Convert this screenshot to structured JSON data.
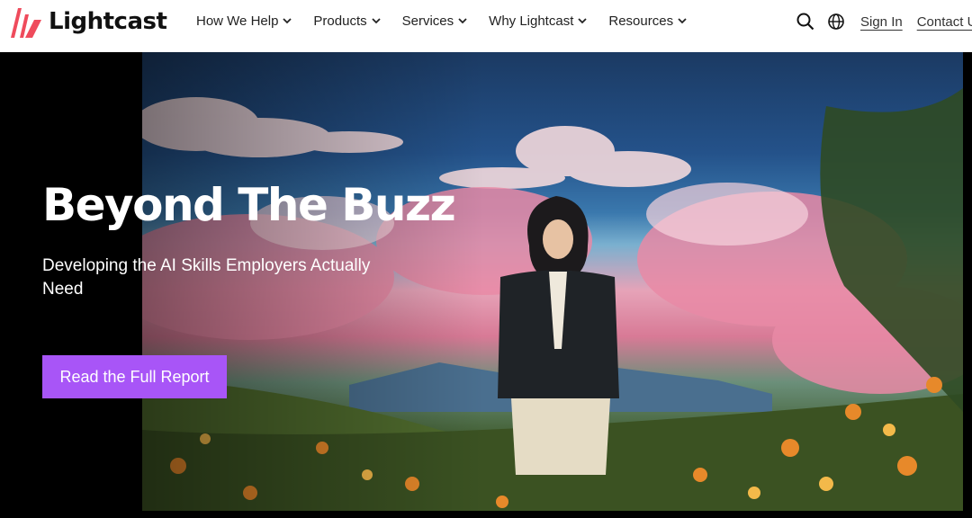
{
  "brand": {
    "name": "Lightcast",
    "color": "#ef4b5c"
  },
  "nav": {
    "items": [
      {
        "label": "How We Help"
      },
      {
        "label": "Products"
      },
      {
        "label": "Services"
      },
      {
        "label": "Why Lightcast"
      },
      {
        "label": "Resources"
      }
    ],
    "icons": [
      "search-icon",
      "globe-icon"
    ],
    "sign_in": "Sign In",
    "contact": "Contact Us"
  },
  "hero": {
    "title": "Beyond The Buzz",
    "subtitle": "Developing the AI Skills Employers Actually Need",
    "cta_label": "Read the Full Report",
    "cta_color": "#a855f7"
  }
}
